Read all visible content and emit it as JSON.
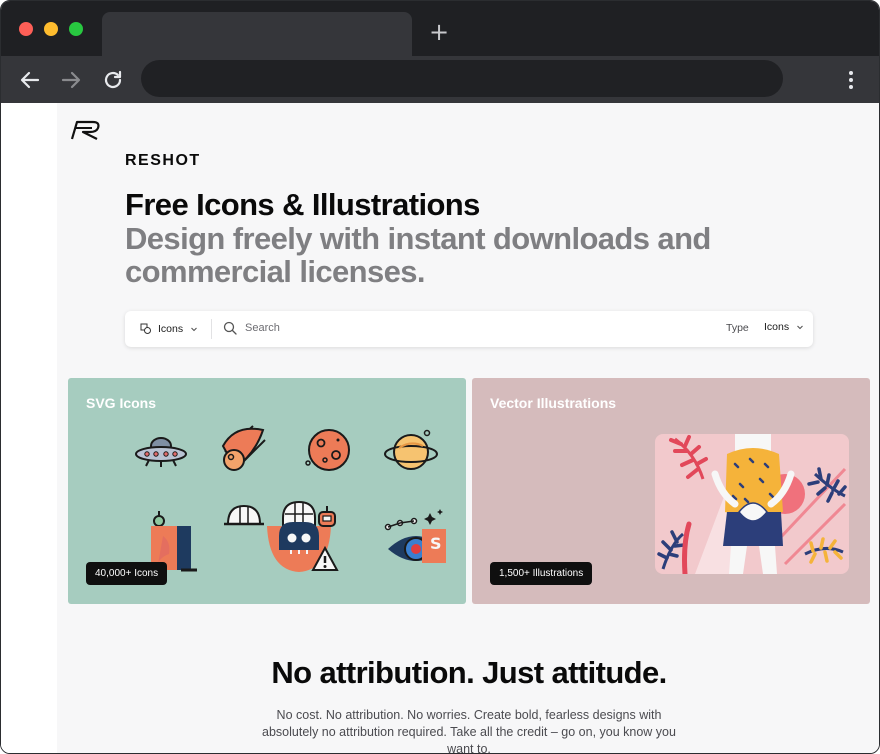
{
  "browser": {
    "window_controls": [
      "close",
      "minimize",
      "maximize"
    ],
    "new_tab_label": "+",
    "nav_icons": [
      "back-arrow-icon",
      "forward-arrow-icon",
      "reload-icon"
    ],
    "menu_icon": "kebab-menu-icon",
    "url": ""
  },
  "site": {
    "brand": "RESHOT",
    "headline": "Free Icons & Illustrations",
    "subheadline": "Design freely with instant downloads and commercial licenses."
  },
  "search": {
    "asset_type": "Icons",
    "placeholder": "Search",
    "type_label": "Type",
    "type_value": "Icons"
  },
  "cards": [
    {
      "title": "SVG Icons",
      "badge": "40,000+ Icons",
      "color": "#a6ccbf"
    },
    {
      "title": "Vector Illustrations",
      "badge": "1,500+ Illustrations",
      "color": "#d5bbbc"
    }
  ],
  "section": {
    "title": "No attribution. Just attitude.",
    "text": "No cost. No attribution. No worries. Create bold, fearless designs with absolutely no attribution required. Take all the credit – go on, you know you want to."
  }
}
